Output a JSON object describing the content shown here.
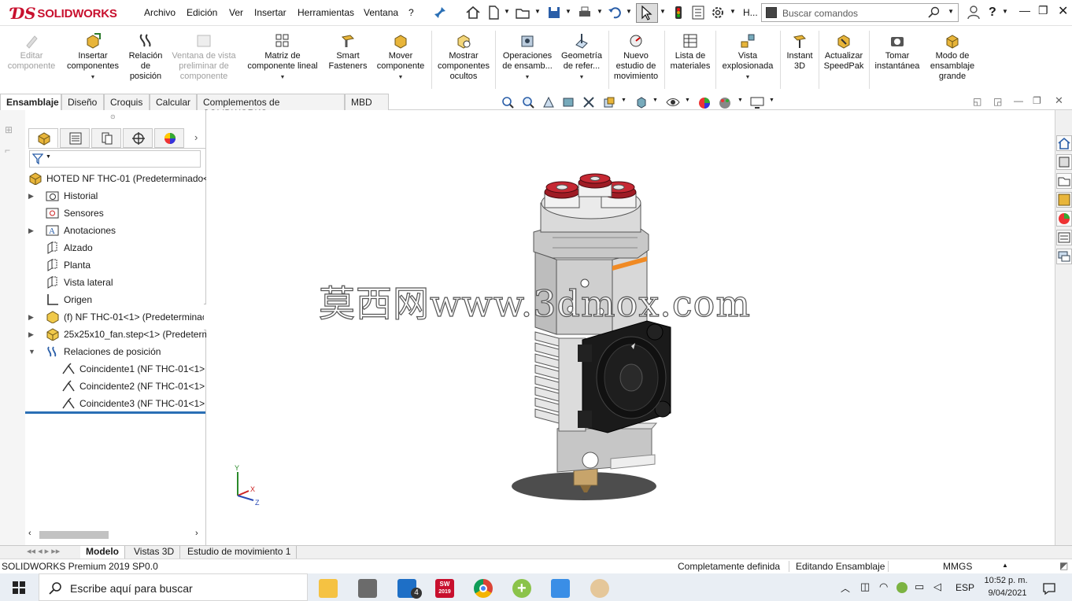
{
  "app": {
    "logo_text": "SOLIDWORKS",
    "menus": [
      "Archivo",
      "Edición",
      "Ver",
      "Insertar",
      "Herramientas",
      "Ventana",
      "?"
    ],
    "search_placeholder": "Buscar comandos",
    "truncated_button": "H..."
  },
  "commands": [
    {
      "label": "Editar componente",
      "icon": "edit-component-icon",
      "enabled": false
    },
    {
      "label": "Insertar componentes",
      "icon": "insert-components-icon",
      "enabled": true
    },
    {
      "label": "Relación de posición",
      "icon": "mate-icon",
      "enabled": true
    },
    {
      "label": "Ventana de vista preliminar de componente",
      "icon": "preview-window-icon",
      "enabled": false
    },
    {
      "label": "Matriz de componente lineal",
      "icon": "linear-pattern-icon",
      "enabled": true
    },
    {
      "label": "Smart Fasteners",
      "icon": "smart-fasteners-icon",
      "enabled": true
    },
    {
      "label": "Mover componente",
      "icon": "move-component-icon",
      "enabled": true
    },
    {
      "label": "Mostrar componentes ocultos",
      "icon": "show-hidden-icon",
      "enabled": true
    },
    {
      "label": "Operaciones de ensamb...",
      "icon": "assembly-features-icon",
      "enabled": true
    },
    {
      "label": "Geometría de refer...",
      "icon": "reference-geometry-icon",
      "enabled": true
    },
    {
      "label": "Nuevo estudio de movimiento",
      "icon": "motion-study-icon",
      "enabled": true
    },
    {
      "label": "Lista de materiales",
      "icon": "bom-icon",
      "enabled": true
    },
    {
      "label": "Vista explosionada",
      "icon": "exploded-view-icon",
      "enabled": true
    },
    {
      "label": "Instant 3D",
      "icon": "instant3d-icon",
      "enabled": true
    },
    {
      "label": "Actualizar SpeedPak",
      "icon": "speedpak-icon",
      "enabled": true
    },
    {
      "label": "Tomar instantánea",
      "icon": "snapshot-icon",
      "enabled": true
    },
    {
      "label": "Modo de ensamblaje grande",
      "icon": "large-assembly-icon",
      "enabled": true
    }
  ],
  "tabs": [
    "Ensamblaje",
    "Diseño",
    "Croquis",
    "Calcular",
    "Complementos de SOLIDWORKS",
    "MBD"
  ],
  "active_tab": "Ensamblaje",
  "tree": {
    "root": "HOTED NF THC-01  (Predeterminado<",
    "items": [
      {
        "label": "Historial",
        "icon": "history-folder-icon",
        "expand": "▶",
        "indent": 1
      },
      {
        "label": "Sensores",
        "icon": "sensors-icon",
        "expand": "",
        "indent": 1
      },
      {
        "label": "Anotaciones",
        "icon": "annotations-icon",
        "expand": "▶",
        "indent": 1
      },
      {
        "label": "Alzado",
        "icon": "plane-icon",
        "expand": "",
        "indent": 1
      },
      {
        "label": "Planta",
        "icon": "plane-icon",
        "expand": "",
        "indent": 1
      },
      {
        "label": "Vista lateral",
        "icon": "plane-icon",
        "expand": "",
        "indent": 1
      },
      {
        "label": "Origen",
        "icon": "origin-icon",
        "expand": "",
        "indent": 1
      },
      {
        "label": "(f) NF THC-01<1> (Predeterminac",
        "icon": "part-fixed-icon",
        "expand": "▶",
        "indent": 1
      },
      {
        "label": "25x25x10_fan.step<1> (Predeterm",
        "icon": "part-icon",
        "expand": "▶",
        "indent": 1
      },
      {
        "label": "Relaciones de posición",
        "icon": "mates-folder-icon",
        "expand": "▼",
        "indent": 1
      },
      {
        "label": "Coincidente1 (NF THC-01<1>",
        "icon": "coincident-mate-icon",
        "expand": "",
        "indent": 2
      },
      {
        "label": "Coincidente2 (NF THC-01<1>",
        "icon": "coincident-mate-icon",
        "expand": "",
        "indent": 2
      },
      {
        "label": "Coincidente3 (NF THC-01<1>",
        "icon": "coincident-mate-icon",
        "expand": "",
        "indent": 2
      }
    ]
  },
  "watermark": "莫西网www.3dmox.com",
  "bottom_tabs": [
    "Modelo",
    "Vistas 3D",
    "Estudio de movimiento 1"
  ],
  "active_bottom_tab": "Modelo",
  "status": {
    "version": "SOLIDWORKS Premium 2019 SP0.0",
    "definition": "Completamente definida",
    "mode": "Editando Ensamblaje",
    "units": "MMGS"
  },
  "taskbar": {
    "search_placeholder": "Escribe aquí para buscar",
    "mail_badge": "4",
    "sw_badge": "2019",
    "language": "ESP",
    "time": "10:52 p. m.",
    "date": "9/04/2021"
  },
  "axis": {
    "x": "X",
    "y": "Y",
    "z": "Z"
  },
  "colors": {
    "brand_red": "#c8102e",
    "selection_blue": "#0078d7",
    "part_gray": "#c4c4c4",
    "fan_black": "#1a1a1a",
    "cap_red": "#b3202a"
  }
}
